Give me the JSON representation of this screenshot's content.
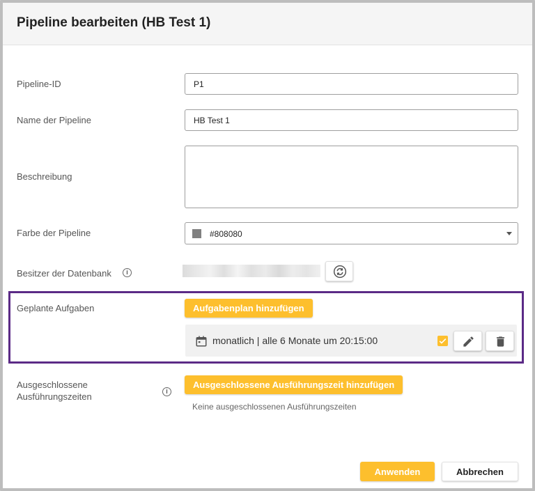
{
  "dialog": {
    "title": "Pipeline bearbeiten (HB Test 1)"
  },
  "form": {
    "pipeline_id": {
      "label": "Pipeline-ID",
      "value": "P1"
    },
    "name": {
      "label": "Name der Pipeline",
      "value": "HB Test 1"
    },
    "description": {
      "label": "Beschreibung",
      "value": ""
    },
    "color": {
      "label": "Farbe der Pipeline",
      "value": "#808080",
      "swatch": "#808080"
    },
    "owner": {
      "label": "Besitzer der Datenbank",
      "info_icon": "info-icon",
      "refresh_icon": "refresh-icon"
    },
    "scheduled_tasks": {
      "label": "Geplante Aufgaben",
      "add_label": "Aufgabenplan hinzufügen",
      "items": [
        {
          "text": "monatlich | alle 6 Monate um 20:15:00",
          "enabled": true
        }
      ]
    },
    "excluded_times": {
      "label_line1": "Ausgeschlossene",
      "label_line2": "Ausführungszeiten",
      "add_label": "Ausgeschlossene Ausführungszeit hinzufügen",
      "empty_text": "Keine ausgeschlossenen Ausführungszeiten"
    }
  },
  "footer": {
    "apply_label": "Anwenden",
    "cancel_label": "Abbrechen"
  },
  "colors": {
    "accent": "#fdbf2d",
    "highlight_border": "#5b2a86"
  }
}
